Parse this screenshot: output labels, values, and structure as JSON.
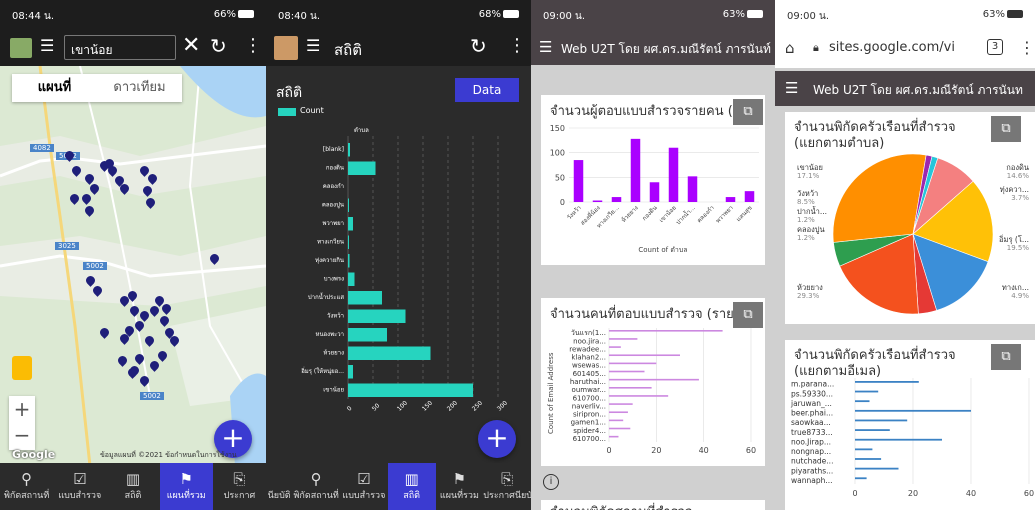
{
  "panel1": {
    "status": {
      "time": "08:44 น.",
      "right": "66%"
    },
    "search_value": "เขาน้อย",
    "map_types": [
      "แผนที่",
      "ดาวเทียม"
    ],
    "roads": [
      "4082",
      "5002",
      "3025",
      "5002",
      "5002"
    ],
    "attribution": "ข้อมูลแผนที่ ©2021   ข้อกำหนดในการใช้งาน",
    "google_label": "Google",
    "nav": [
      "พิกัดสถานที่",
      "แบบสำรวจ",
      "สถิติ",
      "แผนที่รวม",
      "ประกาศ"
    ]
  },
  "panel2": {
    "status": {
      "time": "08:40 น.",
      "right": "68%"
    },
    "app_title": "สถิติ",
    "page_title": "สถิติ",
    "data_button": "Data",
    "nav": [
      "นียบัติ",
      "พิกัดสถานที่",
      "แบบสำรวจ",
      "สถิติ",
      "แผนที่รวม",
      "ประกาศนียบัติ"
    ]
  },
  "panel3": {
    "status": {
      "time": "09:00 น.",
      "right": "63%"
    },
    "header": "Web U2T โดย ผศ.ดร.มณีรัตน์ ภารนันท์",
    "card1_title": "จำนวนผู้ตอบแบบสำรวจรายคน (",
    "card1_xlabel": "Count of ตำบล",
    "card2_title": "จำนวนคนที่ตอบแบบสำรวจ (รายบ",
    "card2_ylabel": "Count of Email Address",
    "info_icon": "i",
    "footer_title": "จำนวนพิกัดสถานที่สำรวจ"
  },
  "panel4": {
    "status": {
      "time": "09:00 น.",
      "right": "63%"
    },
    "url": "sites.google.com/vi",
    "tabs_count": "3",
    "header": "Web U2T โดย ผศ.ดร.มณีรัตน์ ภารนันท",
    "pie_title_1": "จำนวนพิกัดครัวเรือนที่สำรวจ",
    "pie_title_2": "(แยกตามตำบล)",
    "bar_title_1": "จำนวนพิกัดครัวเรือนที่สำรวจ",
    "bar_title_2": "(แยกตามอีเมล)"
  },
  "chart_data": [
    {
      "type": "bar",
      "orientation": "horizontal",
      "title": "",
      "ylabel": "ตำบล",
      "legend": "top-left",
      "series": [
        {
          "name": "Count",
          "color": "#26d4bf"
        }
      ],
      "categories": [
        "[blank]",
        "กองดิน",
        "คลองกำ",
        "คลองปูน",
        "พวาพยา",
        "ทางเกวียน",
        "ทุ่งควายกิน",
        "บางพรง",
        "ปากน้ำประแส",
        "วังหว้า",
        "หนองพะวา",
        "ห้วยยาง",
        "อิ่มรุ (ให้หนุ่ยอ...",
        "เขาน้อย"
      ],
      "values": [
        4,
        55,
        0,
        2,
        10,
        2,
        3,
        13,
        68,
        115,
        78,
        165,
        10,
        250
      ],
      "xticks": [
        "0",
        "50",
        "100",
        "150",
        "200",
        "250",
        "300"
      ],
      "xlim": [
        0,
        300
      ]
    },
    {
      "type": "bar",
      "title": "จำนวนผู้ตอบแบบสำรวจรายคน",
      "xlabel": "Count of ตำบล",
      "color": "#aa00ff",
      "categories": [
        "วังหว้า",
        "สองพี่น้อง",
        "ทางเกวีย...",
        "ห้วยยาง",
        "กองดิน",
        "เขาน้อย",
        "ปากน้ำ...",
        "คลองกำ",
        "พวาพยา",
        "แสนสุข"
      ],
      "values": [
        85,
        3,
        10,
        128,
        40,
        110,
        52,
        0,
        10,
        22
      ],
      "yticks": [
        "0",
        "50",
        "100",
        "150"
      ],
      "ylim": [
        0,
        150
      ]
    },
    {
      "type": "bar",
      "orientation": "horizontal",
      "title": "จำนวนคนที่ตอบแบบสำรวจ",
      "xlabel": "",
      "ylabel": "Count of Email Address",
      "color": "#cc88e0",
      "categories": [
        "วันแรก(1...",
        "noo.jira...",
        "rewadee...",
        "klahan2...",
        "wsewas...",
        "601405...",
        "haruthai...",
        "oumwar...",
        "610700...",
        "naverliv...",
        "siripron...",
        "gamen1...",
        "spider4...",
        "610700..."
      ],
      "values": [
        48,
        12,
        5,
        30,
        20,
        15,
        38,
        18,
        25,
        10,
        8,
        6,
        9,
        4
      ],
      "xticks": [
        "0",
        "20",
        "40",
        "60"
      ],
      "xlim": [
        0,
        60
      ]
    },
    {
      "type": "pie",
      "title": "จำนวนพิกัดครัวเรือนที่สำรวจ (แยกตามตำบล)",
      "slices": [
        {
          "label": "เขาน้อย",
          "pct": "17.1%",
          "value": 17.1,
          "color": "#ffc107"
        },
        {
          "label": "กองดิน",
          "pct": "14.6%",
          "value": 14.6,
          "color": "#3b8fd9"
        },
        {
          "label": "ทุ่งควา...",
          "pct": "3.7%",
          "value": 3.7,
          "color": "#e53935"
        },
        {
          "label": "อิ่มรุ (โ...",
          "pct": "19.5%",
          "value": 19.5,
          "color": "#f4511e"
        },
        {
          "label": "ทางเก...",
          "pct": "4.9%",
          "value": 4.9,
          "color": "#2e9e4f"
        },
        {
          "label": "ห้วยยาง",
          "pct": "29.3%",
          "value": 29.3,
          "color": "#ff8f00"
        },
        {
          "label": "คลองปูน",
          "pct": "1.2%",
          "value": 1.2,
          "color": "#9c27b0"
        },
        {
          "label": "ปากน้ำ...",
          "pct": "1.2%",
          "value": 1.2,
          "color": "#26c6da"
        },
        {
          "label": "วังหว้า",
          "pct": "8.5%",
          "value": 8.5,
          "color": "#f48080"
        }
      ]
    },
    {
      "type": "bar",
      "orientation": "horizontal",
      "title": "จำนวนพิกัดครัวเรือนที่สำรวจ (แยกตามอีเมล)",
      "color": "#3b82c4",
      "categories": [
        "m.parana...",
        "ps.59330...",
        "jaruwan_...",
        "beer.phai...",
        "saowkaa...",
        "true8733...",
        "noo.Jirap...",
        "nongnap...",
        "nutchade...",
        "piyaraths...",
        "wannaph..."
      ],
      "values": [
        22,
        8,
        5,
        40,
        18,
        12,
        30,
        6,
        9,
        15,
        4
      ],
      "xticks": [
        "0",
        "20",
        "40",
        "60"
      ],
      "xlim": [
        0,
        60
      ]
    }
  ]
}
